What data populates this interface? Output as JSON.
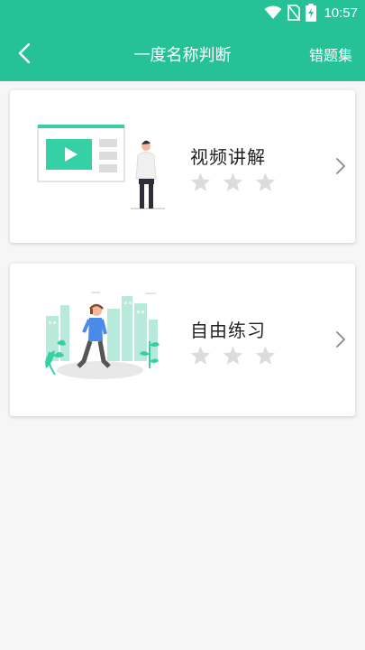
{
  "status_bar": {
    "time": "10:57",
    "icons": [
      "wifi-icon",
      "no-sim-icon",
      "battery-charging-icon"
    ]
  },
  "header": {
    "title": "一度名称判断",
    "right_action": "错题集",
    "back_icon": "chevron-left-icon"
  },
  "cards": [
    {
      "label": "视频讲解",
      "rating_stars": 3,
      "rating_filled": 0,
      "illustration": "video-lesson-illustration"
    },
    {
      "label": "自由练习",
      "rating_stars": 3,
      "rating_filled": 0,
      "illustration": "walking-person-illustration"
    }
  ],
  "colors": {
    "accent": "#26c197",
    "star_empty": "#dcdcdc",
    "illustration_green": "#35d0a5",
    "background": "#f6f6f6"
  }
}
